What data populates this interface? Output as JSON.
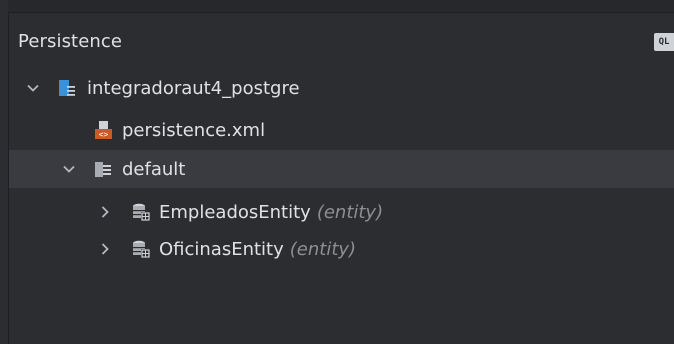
{
  "panel": {
    "title": "Persistence",
    "ql_icon_text": "QL"
  },
  "tree": {
    "unit": {
      "label": "integradoraut4_postgre",
      "icon": "persistence-unit-icon"
    },
    "xml": {
      "label": "persistence.xml",
      "icon": "xml-file-icon"
    },
    "default": {
      "label": "default",
      "icon": "folder-list-icon"
    },
    "entities": [
      {
        "name": "EmpleadosEntity",
        "hint": "(entity)",
        "icon": "database-entity-icon"
      },
      {
        "name": "OficinasEntity",
        "hint": "(entity)",
        "icon": "database-entity-icon"
      }
    ]
  },
  "colors": {
    "background": "#2b2d30",
    "selected_row": "#393b40",
    "accent_blue": "#3d8fd6",
    "xml_orange": "#c75b2a",
    "hint_gray": "#8c8f94"
  }
}
